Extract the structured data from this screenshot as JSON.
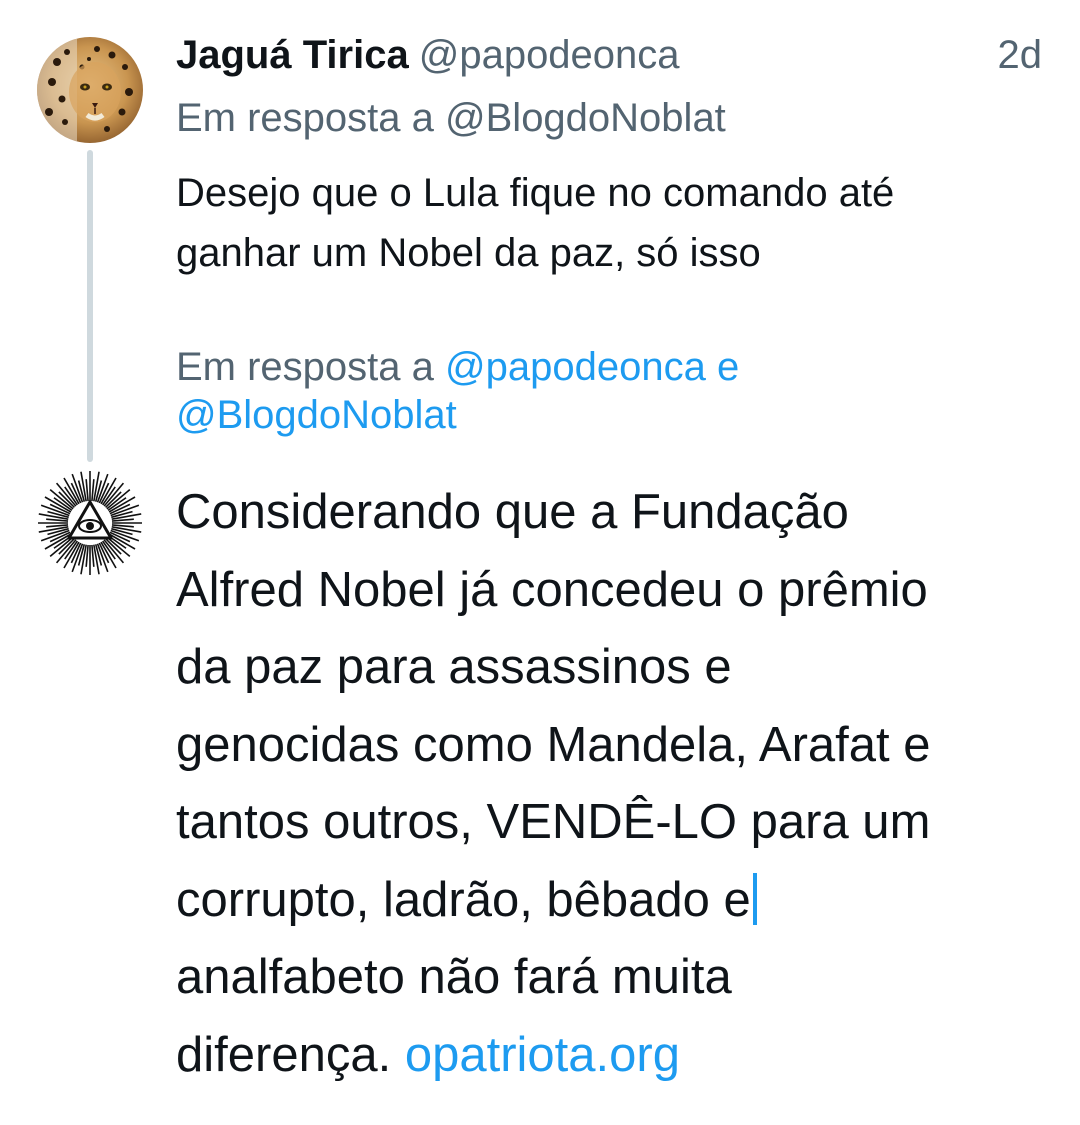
{
  "tweet1": {
    "display_name": "Jaguá Tirica",
    "handle": "@papodeonca",
    "time": "2d",
    "reply_prefix": "Em resposta a",
    "reply_to": "@BlogdoNoblat",
    "text_lines": [
      "Desejo que o Lula fique no comando até",
      "ganhar um Nobel da paz, só isso"
    ],
    "avatar_icon": "jaguar-avatar"
  },
  "tweet2": {
    "reply_prefix": "Em resposta a",
    "reply_to_1": "@papodeonca",
    "reply_conj": "e",
    "reply_to_2": "@BlogdoNoblat",
    "avatar_icon": "all-seeing-eye-avatar",
    "text_lines": [
      "Considerando que a Fundação",
      "Alfred Nobel já concedeu o prêmio",
      "da paz para assassinos e",
      "genocidas como Mandela, Arafat e",
      "tantos outros, VENDÊ-LO para um",
      "corrupto, ladrão, bêbado e",
      "analfabeto não fará muita",
      "diferença."
    ],
    "link": "opatriota.org"
  },
  "colors": {
    "text": "#0f1419",
    "secondary": "#536471",
    "accent": "#1d9bf0",
    "thread_line": "#cfd9de"
  }
}
